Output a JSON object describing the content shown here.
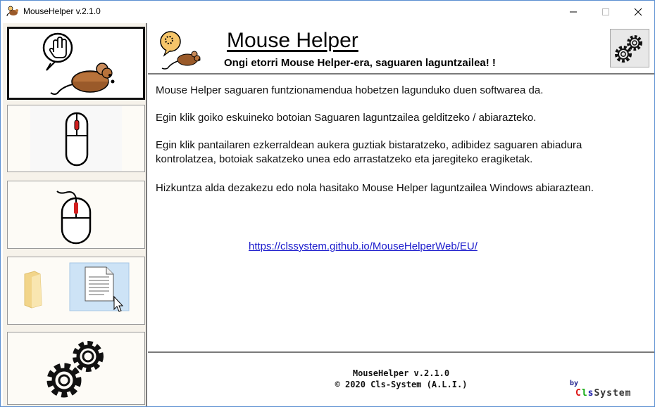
{
  "window": {
    "title": "MouseHelper v.2.1.0"
  },
  "titlebar": {
    "minimize_glyph": "—",
    "maximize_glyph": "☐",
    "close_glyph": "✕"
  },
  "sidebar": {
    "items": [
      {
        "name": "helper-toggle",
        "icon": "hand-mouse-icon",
        "active": true
      },
      {
        "name": "mouse-speed",
        "icon": "mouse-icon"
      },
      {
        "name": "mouse-click",
        "icon": "mouse-click-icon"
      },
      {
        "name": "drag-drop",
        "icon": "folder-document-icon"
      },
      {
        "name": "settings",
        "icon": "gears-icon"
      }
    ]
  },
  "header": {
    "app_name": "Mouse Helper",
    "subtitle": "Ongi etorri Mouse Helper-era, saguaren laguntzailea! !"
  },
  "content": {
    "p1": "Mouse Helper saguaren funtzionamendua hobetzen lagunduko duen softwarea da.",
    "p2": "Egin klik goiko eskuineko botoian Saguaren laguntzailea gelditzeko / abiarazteko.",
    "p3": "Egin klik pantailaren ezkerraldean aukera guztiak bistaratzeko, adibidez saguaren abiadura kontrolatzea, botoiak sakatzeko unea edo arrastatzeko eta jaregiteko eragiketak.",
    "p4": "Hizkuntza alda dezakezu edo nola hasitako Mouse Helper laguntzailea Windows abiaraztean.",
    "link": "https://clssystem.github.io/MouseHelperWeb/EU/"
  },
  "footer": {
    "version": "MouseHelper v.2.1.0",
    "copyright": "©  2020 Cls-System (A.L.I.)",
    "by": "by",
    "brand_c": "C",
    "brand_l": "l",
    "brand_s": "s",
    "brand_rest": "System"
  },
  "colors": {
    "accent_red": "#d11f1f",
    "mouse_brown": "#9a5a2a",
    "link": "#1a1acc"
  }
}
